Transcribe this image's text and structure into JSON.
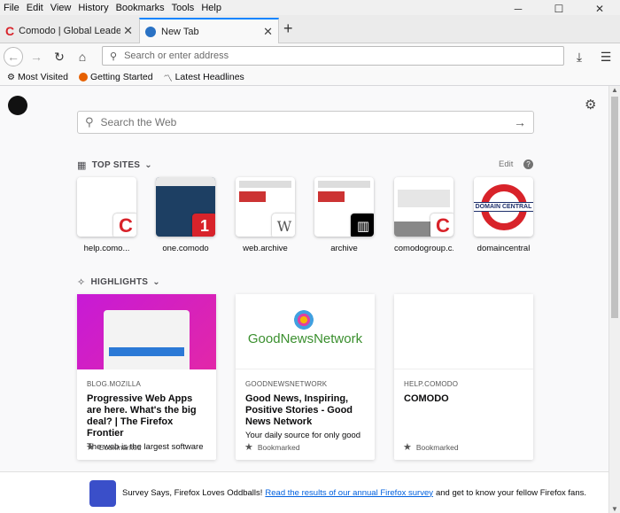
{
  "menubar": {
    "items": [
      "File",
      "Edit",
      "View",
      "History",
      "Bookmarks",
      "Tools",
      "Help"
    ]
  },
  "window": {
    "minimize": "─",
    "maximize": "☐",
    "close": "✕"
  },
  "tabs": [
    {
      "title": "Comodo | Global Leader in Cy",
      "close": "✕"
    },
    {
      "title": "New Tab",
      "close": "✕"
    }
  ],
  "newtab": "+",
  "nav": {
    "url_placeholder": "Search or enter address"
  },
  "bookmarks": [
    {
      "icon": "gear",
      "label": "Most Visited"
    },
    {
      "icon": "firefox",
      "label": "Getting Started"
    },
    {
      "icon": "rss",
      "label": "Latest Headlines"
    }
  ],
  "search": {
    "placeholder": "Search the Web"
  },
  "topsites": {
    "title": "TOP SITES",
    "edit": "Edit",
    "tiles": [
      {
        "label": "help.como..."
      },
      {
        "label": "one.comodo"
      },
      {
        "label": "web.archive"
      },
      {
        "label": "archive"
      },
      {
        "label": "comodogroup.c..."
      },
      {
        "label": "domaincentral"
      }
    ],
    "domain_central_logo": "DOMAIN CENTRAL"
  },
  "highlights": {
    "title": "HIGHLIGHTS",
    "cards": [
      {
        "source": "BLOG.MOZILLA",
        "title": "Progressive Web Apps are here. What's the big deal? | The Firefox Frontier",
        "desc": "The web is the largest software",
        "context": "Bookmarked"
      },
      {
        "source": "GOODNEWSNETWORK",
        "title": "Good News, Inspiring, Positive Stories - Good News Network",
        "desc": "Your daily source for only good",
        "context": "Bookmarked",
        "logo": "GoodNewsNetwork"
      },
      {
        "source": "HELP.COMODO",
        "title": "COMODO",
        "desc": "",
        "context": "Bookmarked"
      }
    ]
  },
  "footer": {
    "pre": "Survey Says, Firefox Loves Oddballs!",
    "link": "Read the results of our annual Firefox survey",
    "post": "and get to know your fellow Firefox fans."
  },
  "colors": {
    "accent": "#0a84ff",
    "comodo_red": "#d8232a",
    "link": "#0060df"
  }
}
